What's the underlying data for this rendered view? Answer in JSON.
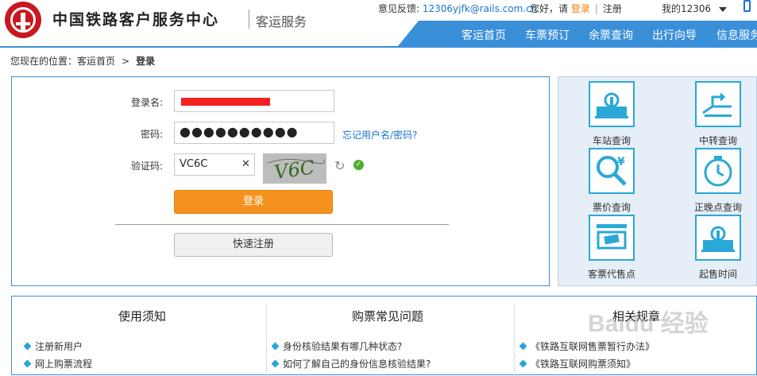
{
  "header": {
    "site_name": "中国铁路客户服务中心",
    "site_sub": "客运服务",
    "feedback_label": "意见反馈:",
    "feedback_email": "12306yjfk@rails.com.cn",
    "greeting": "您好，请",
    "login_link": "登录",
    "register_link": "注册",
    "my_account": "我的12306",
    "nav": [
      "客运首页",
      "车票预订",
      "余票查询",
      "出行向导",
      "信息服务"
    ]
  },
  "breadcrumb": {
    "prefix": "您现在的位置：",
    "home": "客运首页",
    "arrow": ">",
    "current": "登录"
  },
  "login": {
    "username_label": "登录名:",
    "password_label": "密码:",
    "password_value": "●●●●●●●●●●",
    "forgot_link": "忘记用户名/密码?",
    "captcha_label": "验证码:",
    "captcha_value": "VC6C",
    "captcha_image_text": "V6C",
    "login_button": "登录",
    "register_button": "快速注册"
  },
  "quick_links": [
    "车站查询",
    "中转查询",
    "票价查询",
    "正晚点查询",
    "客票代售点",
    "起售时间"
  ],
  "bottom": {
    "columns": [
      {
        "title": "使用须知",
        "items": [
          "注册新用户",
          "网上购票流程"
        ]
      },
      {
        "title": "购票常见问题",
        "items": [
          "身份核验结果有哪几种状态?",
          "如何了解自己的身份信息核验结果?"
        ]
      },
      {
        "title": "相关规章",
        "items": [
          "《铁路互联网售票暂行办法》",
          "《铁路互联网购票须知》"
        ]
      }
    ]
  },
  "watermark": "Baidu 经验",
  "colors": {
    "brand_red": "#c8171e",
    "nav_blue": "#3a8fd9",
    "login_orange": "#f5921e",
    "icon_cyan": "#2aa8d8"
  }
}
